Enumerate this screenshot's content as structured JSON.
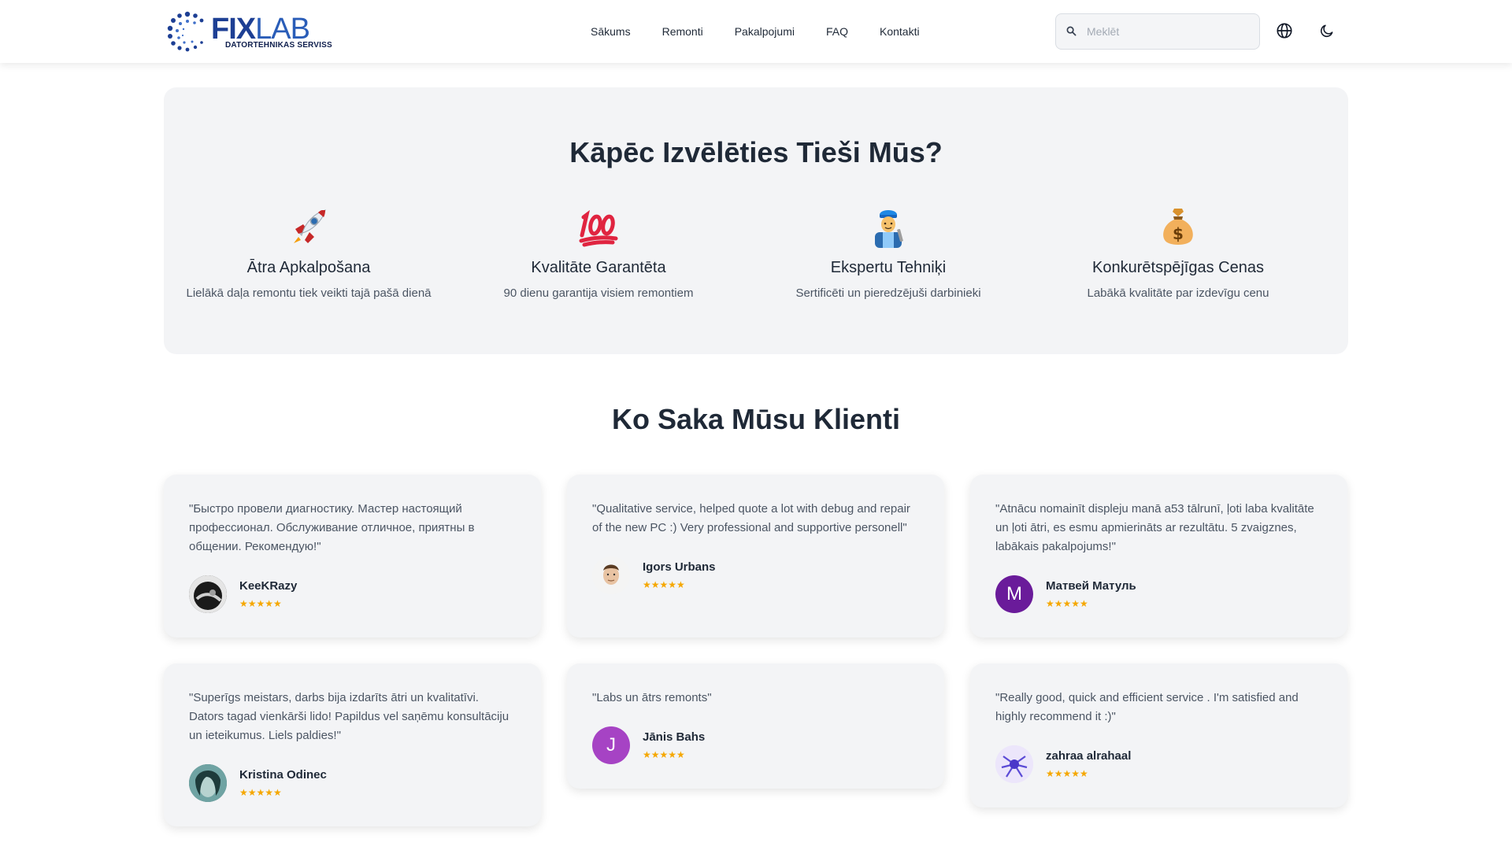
{
  "header": {
    "logo": {
      "fix": "FIX",
      "lab": "LAB",
      "subtitle": "DATORTEHNIKAS SERVISS"
    },
    "nav": [
      {
        "label": "Sākums",
        "name": "nav-sakums"
      },
      {
        "label": "Remonti",
        "name": "nav-remonti"
      },
      {
        "label": "Pakalpojumi",
        "name": "nav-pakalpojumi"
      },
      {
        "label": "FAQ",
        "name": "nav-faq"
      },
      {
        "label": "Kontakti",
        "name": "nav-kontakti"
      }
    ],
    "search": {
      "placeholder": "Meklēt",
      "icon": "search-icon"
    },
    "icons": [
      "globe-icon",
      "moon-icon"
    ]
  },
  "why": {
    "title": "Kāpēc Izvēlēties Tieši Mūs?",
    "features": [
      {
        "icon": "rocket-icon",
        "title": "Ātra Apkalpošana",
        "text": "Lielākā daļa remontu tiek veikti tajā pašā dienā"
      },
      {
        "icon": "hundred-points-icon",
        "title": "Kvalitāte Garantēta",
        "text": "90 dienu garantija visiem remontiem"
      },
      {
        "icon": "mechanic-icon",
        "title": "Ekspertu Tehniķi",
        "text": "Sertificēti un pieredzējuši darbinieki"
      },
      {
        "icon": "money-bag-icon",
        "title": "Konkurētspējīgas Cenas",
        "text": "Labākā kvalitāte par izdevīgu cenu"
      }
    ]
  },
  "testimonials": {
    "title": "Ko Saka Mūsu Klienti",
    "items": [
      {
        "quote": "\"Быстро провели диагностику. Мастер настоящий профессионал. Обслуживание отличное, приятны в общении. Рекомендую!\"",
        "name": "KeeKRazy",
        "stars": "★★★★★",
        "avatar": "photo"
      },
      {
        "quote": "\"Qualitative service, helped quote a lot with debug and repair of the new PC :) Very professional and supportive personell\"",
        "name": "Igors Urbans",
        "stars": "★★★★★",
        "avatar": "photo"
      },
      {
        "quote": "\"Atnācu nomainīt displeju manā a53 tālrunī, ļoti laba kvalitāte un ļoti ātri, es esmu apmierināts ar rezultātu. 5 zvaigznes, labākais pakalpojums!\"",
        "name": "Матвей Матуль",
        "stars": "★★★★★",
        "avatar": "letter",
        "letter": "M",
        "color": "#6a1b9a"
      },
      {
        "quote": "\"Superīgs meistars, darbs bija izdarīts ātri un kvalitatīvi. Dators tagad vienkārši lido! Papildus vel saņēmu konsultāciju un ieteikumus. Liels paldies!\"",
        "name": "Kristina Odinec",
        "stars": "★★★★★",
        "avatar": "photo"
      },
      {
        "quote": "\"Labs un ātrs remonts\"",
        "name": "Jānis Bahs",
        "stars": "★★★★★",
        "avatar": "letter",
        "letter": "J",
        "color": "#a643c4"
      },
      {
        "quote": "\"Really good, quick and efficient service . I'm satisfied and highly recommend it :)\"",
        "name": "zahraa alrahaal",
        "stars": "★★★★★",
        "avatar": "photo"
      }
    ]
  }
}
